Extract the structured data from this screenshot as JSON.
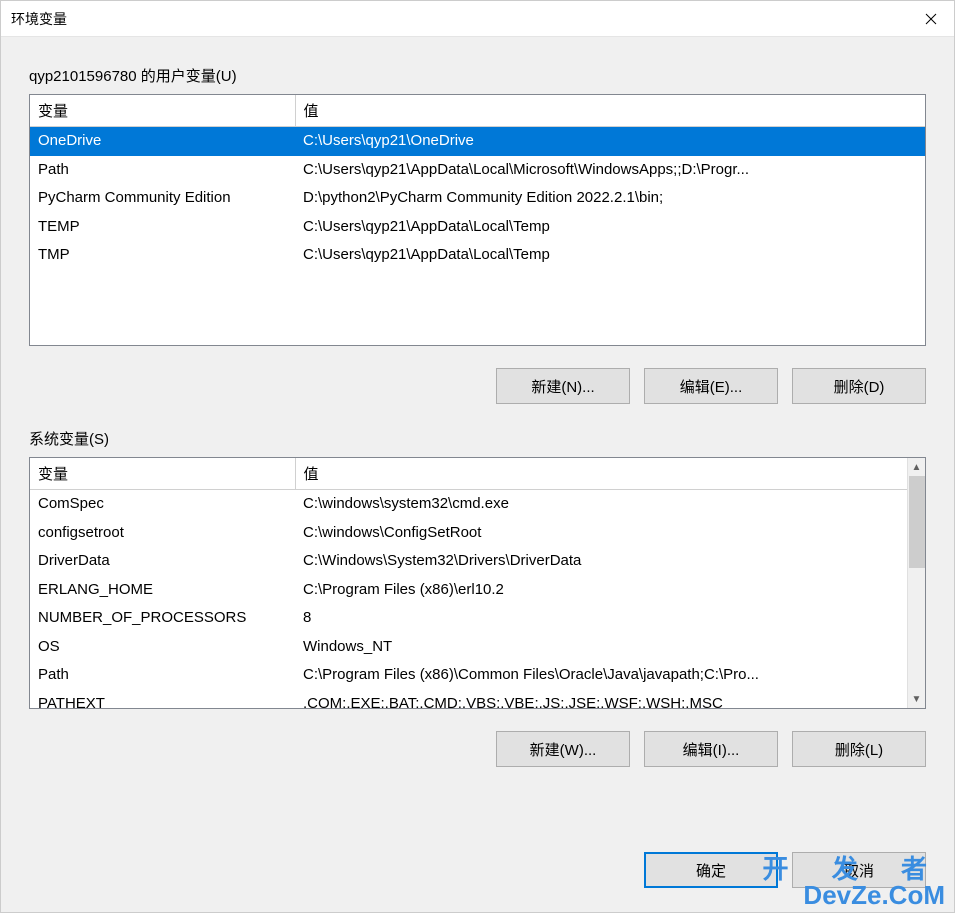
{
  "window": {
    "title": "环境变量"
  },
  "user_section": {
    "label": "qyp2101596780 的用户变量(U)",
    "columns": {
      "variable": "变量",
      "value": "值"
    },
    "rows": [
      {
        "variable": "OneDrive",
        "value": "C:\\Users\\qyp21\\OneDrive",
        "selected": true
      },
      {
        "variable": "Path",
        "value": "C:\\Users\\qyp21\\AppData\\Local\\Microsoft\\WindowsApps;;D:\\Progr...",
        "selected": false
      },
      {
        "variable": "PyCharm Community Edition",
        "value": "D:\\python2\\PyCharm Community Edition 2022.2.1\\bin;",
        "selected": false
      },
      {
        "variable": "TEMP",
        "value": "C:\\Users\\qyp21\\AppData\\Local\\Temp",
        "selected": false
      },
      {
        "variable": "TMP",
        "value": "C:\\Users\\qyp21\\AppData\\Local\\Temp",
        "selected": false
      }
    ],
    "buttons": {
      "new": "新建(N)...",
      "edit": "编辑(E)...",
      "delete": "删除(D)"
    }
  },
  "system_section": {
    "label": "系统变量(S)",
    "columns": {
      "variable": "变量",
      "value": "值"
    },
    "rows": [
      {
        "variable": "ComSpec",
        "value": "C:\\windows\\system32\\cmd.exe"
      },
      {
        "variable": "configsetroot",
        "value": "C:\\windows\\ConfigSetRoot"
      },
      {
        "variable": "DriverData",
        "value": "C:\\Windows\\System32\\Drivers\\DriverData"
      },
      {
        "variable": "ERLANG_HOME",
        "value": "C:\\Program Files (x86)\\erl10.2"
      },
      {
        "variable": "NUMBER_OF_PROCESSORS",
        "value": "8"
      },
      {
        "variable": "OS",
        "value": "Windows_NT"
      },
      {
        "variable": "Path",
        "value": "C:\\Program Files (x86)\\Common Files\\Oracle\\Java\\javapath;C:\\Pro..."
      },
      {
        "variable": "PATHEXT",
        "value": ".COM;.EXE;.BAT;.CMD;.VBS;.VBE;.JS;.JSE;.WSF;.WSH;.MSC"
      }
    ],
    "buttons": {
      "new": "新建(W)...",
      "edit": "编辑(I)...",
      "delete": "删除(L)"
    }
  },
  "dialog_buttons": {
    "ok": "确定",
    "cancel": "取消"
  },
  "watermark": {
    "line1": "开 发 者",
    "line2": "DevZe.CoM"
  }
}
